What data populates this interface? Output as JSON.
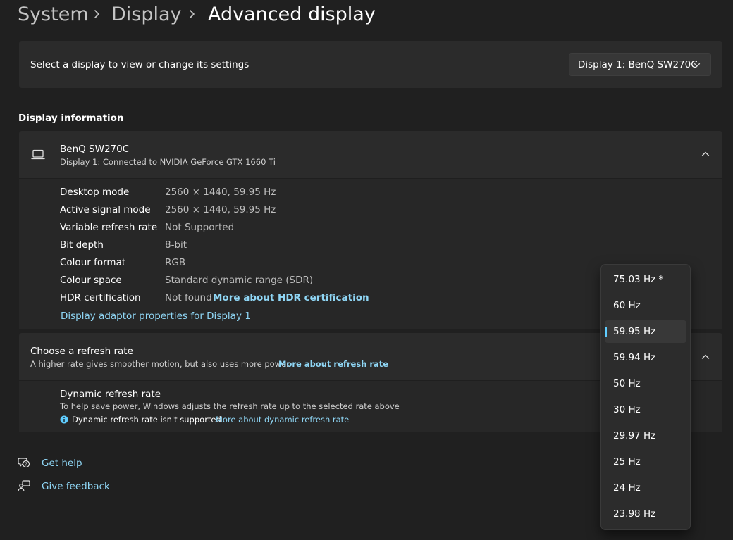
{
  "breadcrumb": {
    "items": [
      "System",
      "Display"
    ],
    "current": "Advanced display"
  },
  "display_select": {
    "label": "Select a display to view or change its settings",
    "value": "Display 1: BenQ SW270C"
  },
  "display_information": {
    "section_title": "Display information",
    "monitor_name": "BenQ SW270C",
    "monitor_subtitle": "Display 1: Connected to NVIDIA GeForce GTX 1660 Ti",
    "rows": [
      {
        "label": "Desktop mode",
        "value": "2560 × 1440, 59.95 Hz"
      },
      {
        "label": "Active signal mode",
        "value": "2560 × 1440, 59.95 Hz"
      },
      {
        "label": "Variable refresh rate",
        "value": "Not Supported"
      },
      {
        "label": "Bit depth",
        "value": "8-bit"
      },
      {
        "label": "Colour format",
        "value": "RGB"
      },
      {
        "label": "Colour space",
        "value": "Standard dynamic range (SDR)"
      },
      {
        "label": "HDR certification",
        "value": "Not found"
      }
    ],
    "hdr_link": "More about HDR certification",
    "adapter_link": "Display adaptor properties for Display 1"
  },
  "refresh_rate": {
    "title": "Choose a refresh rate",
    "subtitle": "A higher rate gives smoother motion, but also uses more power",
    "link": "More about refresh rate",
    "dynamic": {
      "title": "Dynamic refresh rate",
      "description": "To help save power, Windows adjusts the refresh rate up to the selected rate above",
      "warning": "Dynamic refresh rate isn't supported",
      "link": "More about dynamic refresh rate"
    },
    "options": [
      "75.03 Hz *",
      "60 Hz",
      "59.95 Hz",
      "59.94 Hz",
      "50 Hz",
      "30 Hz",
      "29.97 Hz",
      "25 Hz",
      "24 Hz",
      "23.98 Hz"
    ],
    "selected": "59.95 Hz"
  },
  "footer": {
    "help": "Get help",
    "feedback": "Give feedback"
  },
  "colors": {
    "background": "#202020",
    "card": "#2b2b2b",
    "accent": "#60cdff",
    "link": "#8fd6f5"
  },
  "icons": [
    "chevron-right-icon",
    "chevron-down-icon",
    "chevron-up-icon",
    "laptop-icon",
    "info-icon",
    "help-icon",
    "feedback-icon"
  ]
}
